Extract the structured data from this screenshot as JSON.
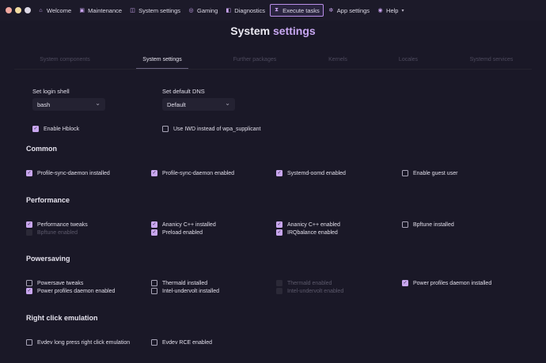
{
  "colors": {
    "background": "#1a1827",
    "accent": "#c8a7f2",
    "check": "#c9a7ef"
  },
  "nav": [
    {
      "icon": "home-icon",
      "label": "Welcome"
    },
    {
      "icon": "wrench-icon",
      "label": "Maintenance"
    },
    {
      "icon": "settings-icon",
      "label": "System settings"
    },
    {
      "icon": "gamepad-icon",
      "label": "Gaming"
    },
    {
      "icon": "diagnostics-icon",
      "label": "Diagnostics"
    },
    {
      "icon": "hourglass-icon",
      "label": "Execute tasks",
      "active": true
    },
    {
      "icon": "gear-icon",
      "label": "App settings"
    },
    {
      "icon": "help-icon",
      "label": "Help"
    }
  ],
  "title": {
    "part1": "System",
    "part2": "settings"
  },
  "tabs": [
    "System components",
    "System settings",
    "Further packages",
    "Kernels",
    "Locales",
    "Systemd services"
  ],
  "active_tab": "System settings",
  "login_shell": {
    "label": "Set login shell",
    "value": "bash"
  },
  "dns": {
    "label": "Set default DNS",
    "value": "Default"
  },
  "top_checks": [
    {
      "label": "Enable Hblock",
      "checked": true
    },
    {
      "label": "Use IWD instead of wpa_supplicant",
      "checked": false
    }
  ],
  "sections": {
    "common": "Common",
    "performance": "Performance",
    "powersaving": "Powersaving",
    "rce": "Right click emulation"
  },
  "common": [
    {
      "label": "Profile-sync-daemon installed",
      "checked": true
    },
    {
      "label": "Profile-sync-daemon enabled",
      "checked": true
    },
    {
      "label": "Systemd-oomd enabled",
      "checked": true
    },
    {
      "label": "Enable guest user",
      "checked": false
    }
  ],
  "performance": [
    {
      "label": "Performance tweaks",
      "checked": true
    },
    {
      "label": "Bpftune enabled",
      "checked": false,
      "disabled": true
    },
    {
      "label": "Ananicy C++ installed",
      "checked": true
    },
    {
      "label": "Preload enabled",
      "checked": true
    },
    {
      "label": "Ananicy C++ enabled",
      "checked": true
    },
    {
      "label": "IRQbalance enabled",
      "checked": true
    },
    {
      "label": "Bpftune installed",
      "checked": false
    }
  ],
  "powersaving": [
    {
      "label": "Powersave tweaks",
      "checked": false
    },
    {
      "label": "Power profiles daemon enabled",
      "checked": true
    },
    {
      "label": "Thermald installed",
      "checked": false
    },
    {
      "label": "Intel-undervolt installed",
      "checked": false
    },
    {
      "label": "Thermald enabled",
      "checked": false,
      "disabled": true
    },
    {
      "label": "Intel-undervolt enabled",
      "checked": false,
      "disabled": true
    },
    {
      "label": "Power profiles daemon installed",
      "checked": true
    }
  ],
  "rce": [
    {
      "label": "Evdev long press right click emulation",
      "checked": false
    },
    {
      "label": "Evdev RCE enabled",
      "checked": false
    }
  ]
}
